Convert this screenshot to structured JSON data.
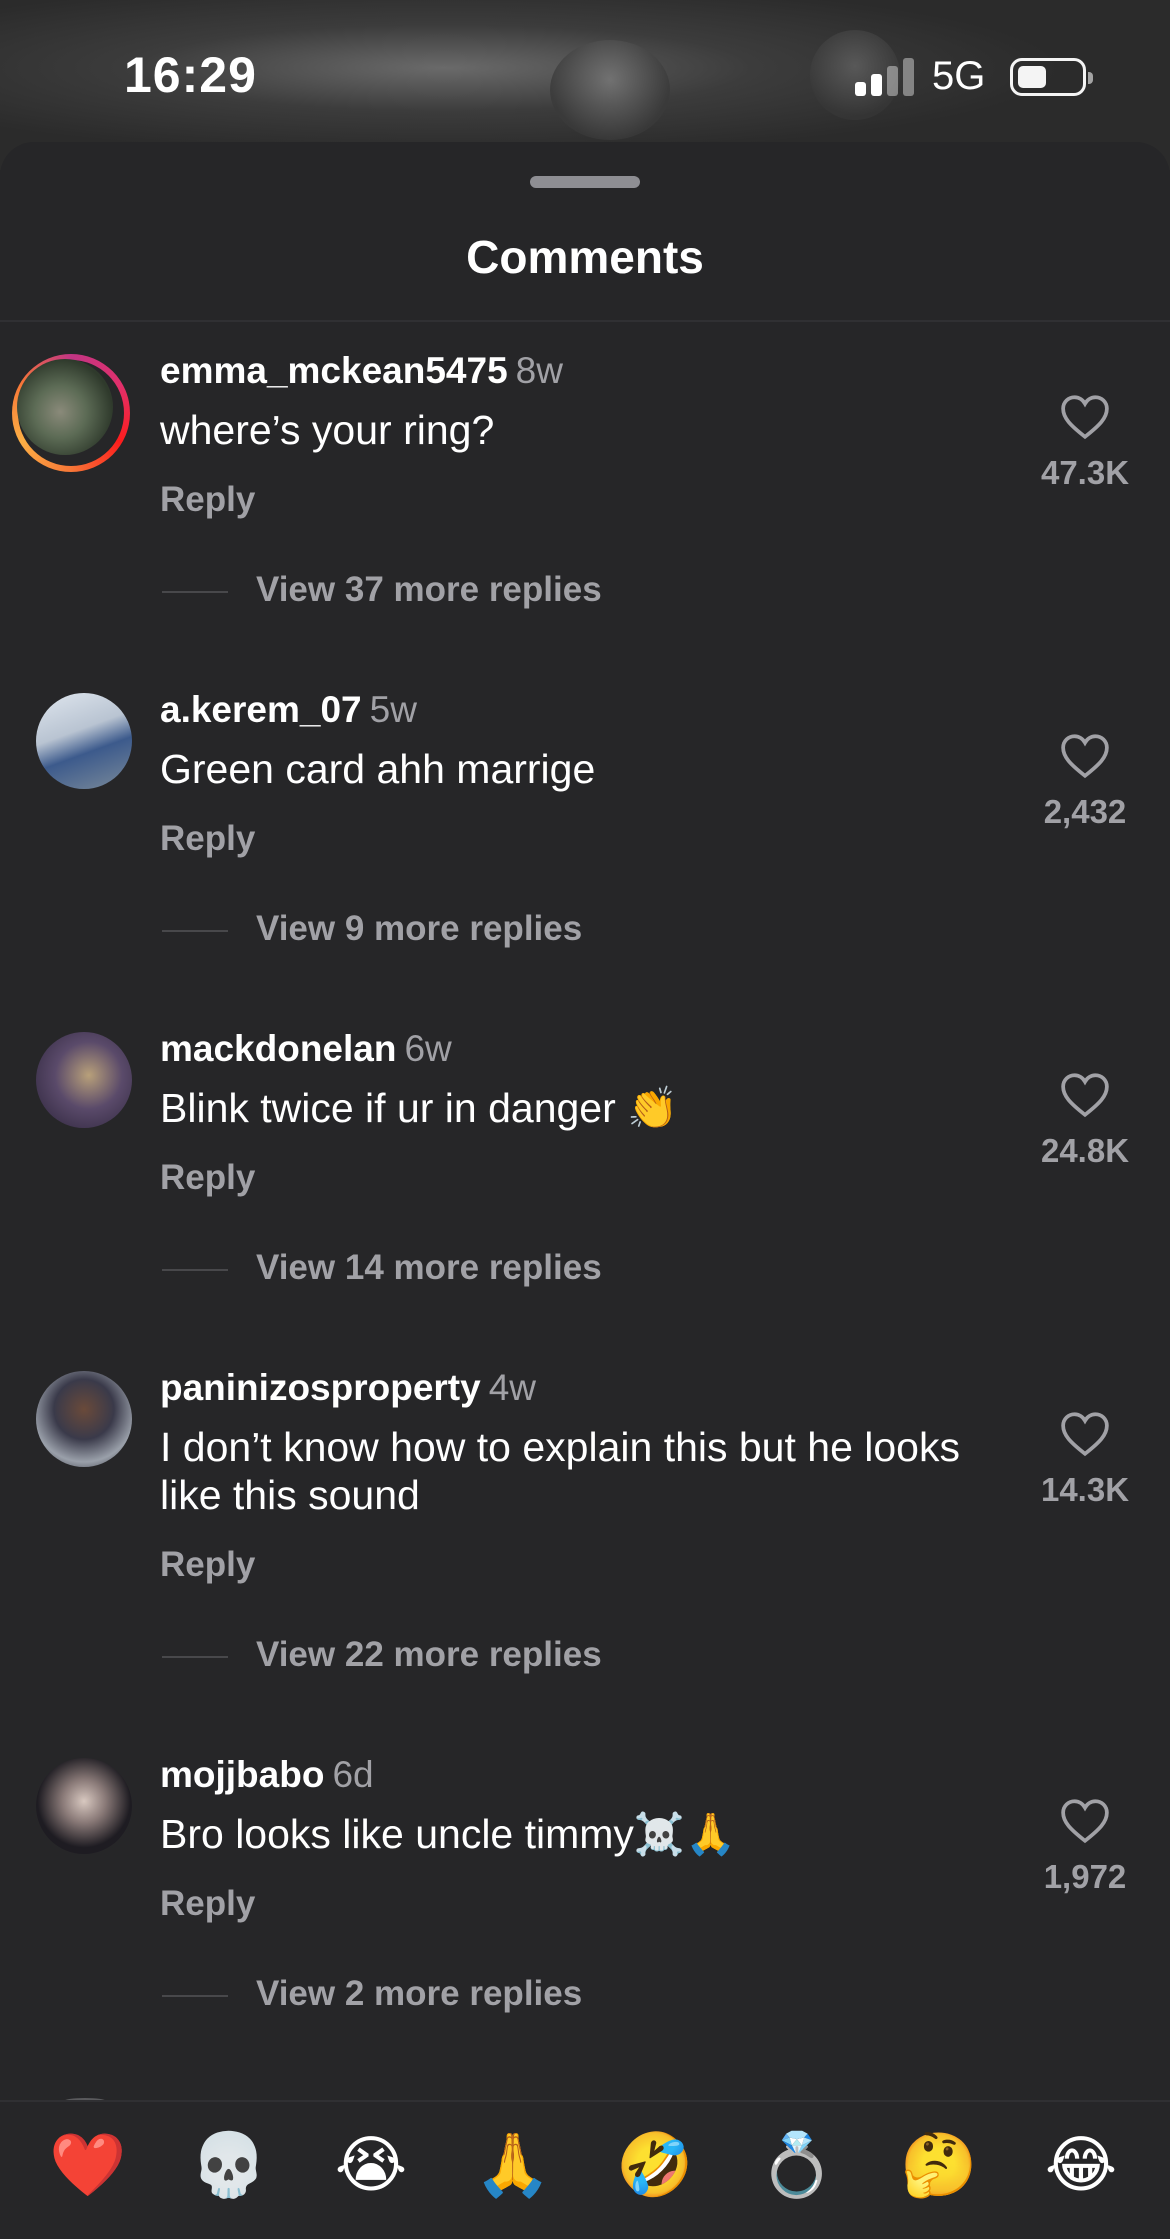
{
  "status": {
    "time": "16:29",
    "network": "5G"
  },
  "sheet": {
    "title": "Comments"
  },
  "comments": [
    {
      "username": "emma_mckean5475",
      "age": "8w",
      "text": "where’s your ring?",
      "reply": "Reply",
      "likes": "47.3K",
      "view_more": "View 37 more replies"
    },
    {
      "username": "a.kerem_07",
      "age": "5w",
      "text": "Green card ahh marrige",
      "reply": "Reply",
      "likes": "2,432",
      "view_more": "View 9 more replies"
    },
    {
      "username": "mackdonelan",
      "age": "6w",
      "text": "Blink twice if ur in danger 👏",
      "reply": "Reply",
      "likes": "24.8K",
      "view_more": "View 14 more replies"
    },
    {
      "username": "paninizosproperty",
      "age": "4w",
      "text": "I don’t know how to explain this but he looks like this sound",
      "reply": "Reply",
      "likes": "14.3K",
      "view_more": "View 22 more replies"
    },
    {
      "username": "mojjbabo",
      "age": "6d",
      "text": "Bro looks like uncle timmy☠️🙏",
      "reply": "Reply",
      "likes": "1,972",
      "view_more": "View 2 more replies"
    }
  ],
  "emoji_bar": [
    "❤️",
    "💀",
    "😭",
    "🙏",
    "🤣",
    "💍",
    "🤔",
    "😂"
  ]
}
